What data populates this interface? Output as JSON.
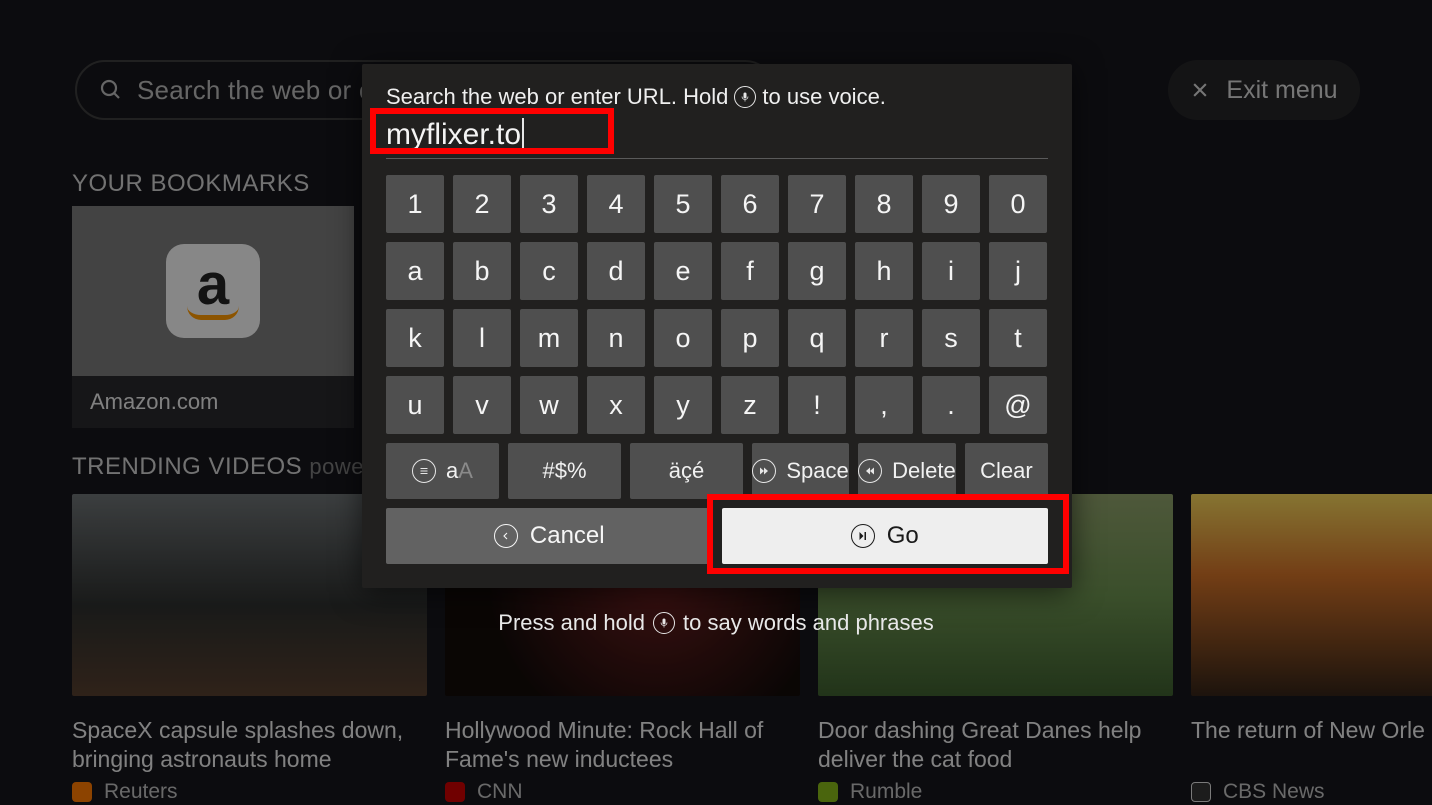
{
  "background": {
    "search_placeholder": "Search the web or en",
    "exit_label": "Exit menu",
    "bookmarks_header": "YOUR BOOKMARKS",
    "bookmark_caption": "Amazon.com",
    "trending_header": "TRENDING VIDEOS",
    "trending_suffix": "powered by",
    "videos": [
      {
        "title": "SpaceX capsule splashes down, bringing astronauts home",
        "source": "Reuters"
      },
      {
        "title": "Hollywood Minute: Rock Hall of Fame's new inductees",
        "source": "CNN"
      },
      {
        "title": "Door dashing Great Danes help deliver the cat food",
        "source": "Rumble"
      },
      {
        "title": "The return of New Orle Festival",
        "source": "CBS News"
      }
    ]
  },
  "modal": {
    "prompt_prefix": "Search the web or enter URL. Hold",
    "prompt_suffix": "to use voice.",
    "input_value": "myflixer.to",
    "keys_row1": [
      "1",
      "2",
      "3",
      "4",
      "5",
      "6",
      "7",
      "8",
      "9",
      "0"
    ],
    "keys_row2": [
      "a",
      "b",
      "c",
      "d",
      "e",
      "f",
      "g",
      "h",
      "i",
      "j"
    ],
    "keys_row3": [
      "k",
      "l",
      "m",
      "n",
      "o",
      "p",
      "q",
      "r",
      "s",
      "t"
    ],
    "keys_row4": [
      "u",
      "v",
      "w",
      "x",
      "y",
      "z",
      "!",
      ",",
      ".",
      "@"
    ],
    "fn_aA_a": "a",
    "fn_aA_A": "A",
    "fn_symbols": "#$%",
    "fn_accents": "äçé",
    "fn_space": "Space",
    "fn_delete": "Delete",
    "fn_clear": "Clear",
    "cancel": "Cancel",
    "go": "Go"
  },
  "footer_hint_prefix": "Press and hold",
  "footer_hint_suffix": "to say words and phrases"
}
